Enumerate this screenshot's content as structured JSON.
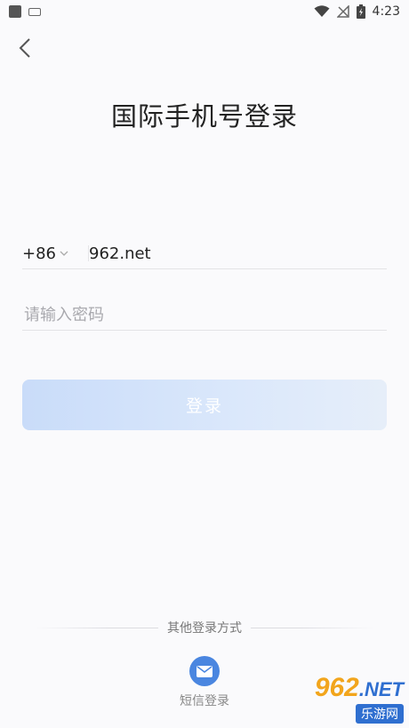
{
  "status_bar": {
    "time": "4:23"
  },
  "header": {
    "title": "国际手机号登录"
  },
  "form": {
    "country_code": "+86",
    "phone_value": "962.net",
    "password_placeholder": "请输入密码",
    "login_label": "登录"
  },
  "other_login": {
    "label": "其他登录方式",
    "sms_label": "短信登录"
  },
  "watermark": {
    "top": "962",
    "top_suffix": ".NET",
    "bottom": "乐游网"
  },
  "colors": {
    "accent": "#4a86e0",
    "button_disabled": "#d6e4fa"
  }
}
